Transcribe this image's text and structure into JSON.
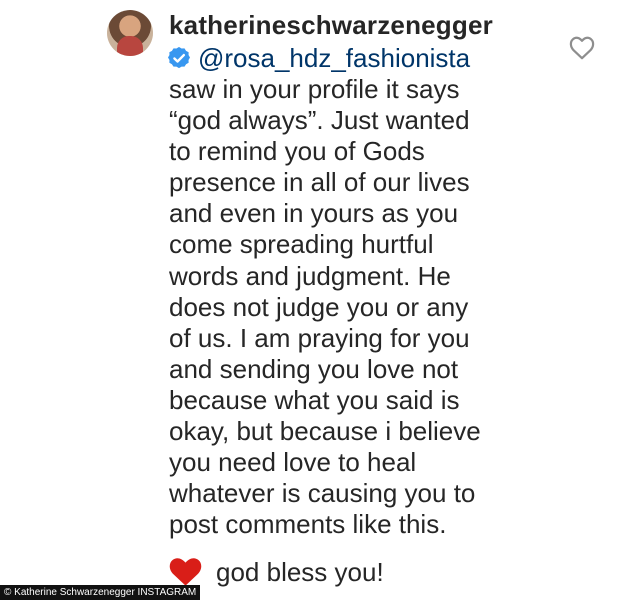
{
  "comment": {
    "username": "katherineschwarzenegger",
    "mention": "@rosa_hdz_fashionista",
    "lines": [
      "saw in your profile it says",
      "“god always”. Just wanted",
      "to remind you of Gods",
      "presence in all of our lives",
      "and even in yours as you",
      "come spreading hurtful",
      "words and judgment. He",
      "does not judge you or any",
      "of us. I am praying for you",
      "and sending you love not",
      "because what you said is",
      "okay, but because i believe",
      "you need love to heal",
      "whatever is causing you to",
      "post comments like this."
    ],
    "closing_text": "god bless you!"
  },
  "caption": {
    "text": "© Katherine Schwarzenegger INSTAGRAM"
  },
  "icons": {
    "verified": "verified-badge-icon",
    "like": "heart-outline-icon",
    "emoji": "red-heart-icon"
  },
  "colors": {
    "text": "#262626",
    "verified": "#3897f0",
    "heart_red": "#d91e18",
    "like_outline": "#8e8e8e",
    "caption_bg": "#111111",
    "caption_text": "#ffffff"
  }
}
